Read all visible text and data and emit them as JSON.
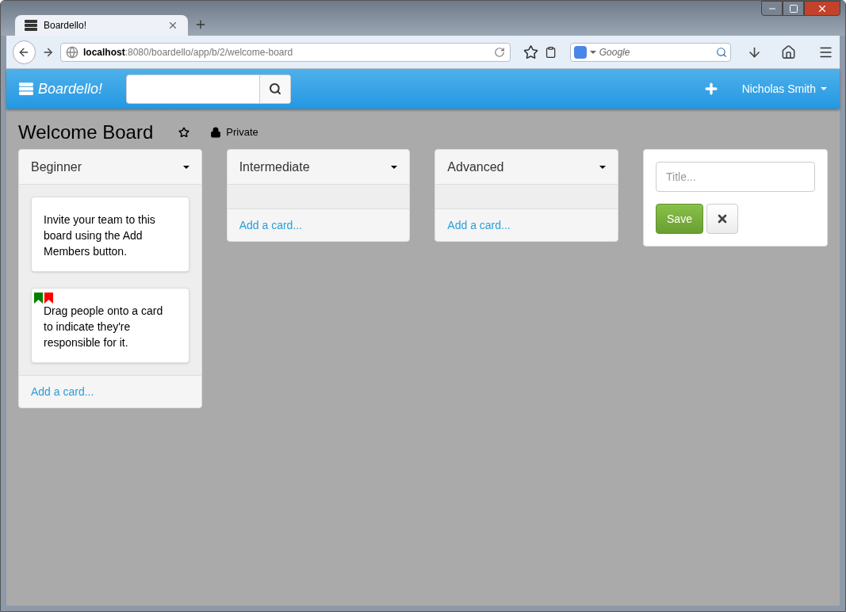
{
  "browser": {
    "tab_title": "Boardello!",
    "url_host": "localhost",
    "url_path": ":8080/boardello/app/b/2/welcome-board",
    "search_placeholder": "Google"
  },
  "navbar": {
    "brand": "Boardello!",
    "user": "Nicholas Smith"
  },
  "board": {
    "title": "Welcome Board",
    "visibility": "Private"
  },
  "lists": [
    {
      "title": "Beginner",
      "cards": [
        {
          "text": "Invite your team to this board using the Add Members button."
        },
        {
          "text": "Drag people onto a card to indicate they're responsible for it.",
          "labels": [
            {
              "color": "#008000"
            },
            {
              "color": "#ff0000"
            }
          ]
        }
      ],
      "add_link": "Add a card..."
    },
    {
      "title": "Intermediate",
      "add_link": "Add a card..."
    },
    {
      "title": "Advanced",
      "add_link": "Add a card..."
    }
  ],
  "new_list": {
    "placeholder": "Title...",
    "save": "Save"
  }
}
